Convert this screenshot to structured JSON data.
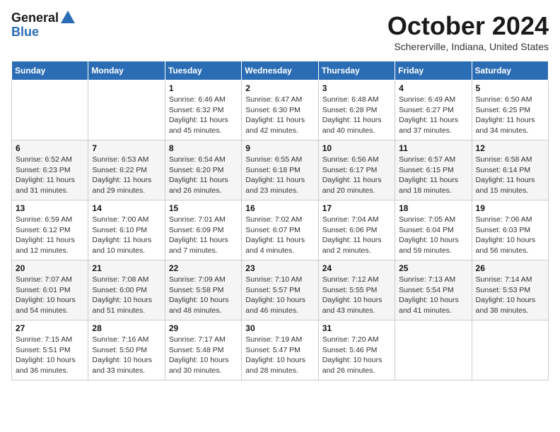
{
  "header": {
    "logo_general": "General",
    "logo_blue": "Blue",
    "month": "October 2024",
    "location": "Schererville, Indiana, United States"
  },
  "weekdays": [
    "Sunday",
    "Monday",
    "Tuesday",
    "Wednesday",
    "Thursday",
    "Friday",
    "Saturday"
  ],
  "weeks": [
    [
      {
        "day": "",
        "sunrise": "",
        "sunset": "",
        "daylight": ""
      },
      {
        "day": "",
        "sunrise": "",
        "sunset": "",
        "daylight": ""
      },
      {
        "day": "1",
        "sunrise": "Sunrise: 6:46 AM",
        "sunset": "Sunset: 6:32 PM",
        "daylight": "Daylight: 11 hours and 45 minutes."
      },
      {
        "day": "2",
        "sunrise": "Sunrise: 6:47 AM",
        "sunset": "Sunset: 6:30 PM",
        "daylight": "Daylight: 11 hours and 42 minutes."
      },
      {
        "day": "3",
        "sunrise": "Sunrise: 6:48 AM",
        "sunset": "Sunset: 6:28 PM",
        "daylight": "Daylight: 11 hours and 40 minutes."
      },
      {
        "day": "4",
        "sunrise": "Sunrise: 6:49 AM",
        "sunset": "Sunset: 6:27 PM",
        "daylight": "Daylight: 11 hours and 37 minutes."
      },
      {
        "day": "5",
        "sunrise": "Sunrise: 6:50 AM",
        "sunset": "Sunset: 6:25 PM",
        "daylight": "Daylight: 11 hours and 34 minutes."
      }
    ],
    [
      {
        "day": "6",
        "sunrise": "Sunrise: 6:52 AM",
        "sunset": "Sunset: 6:23 PM",
        "daylight": "Daylight: 11 hours and 31 minutes."
      },
      {
        "day": "7",
        "sunrise": "Sunrise: 6:53 AM",
        "sunset": "Sunset: 6:22 PM",
        "daylight": "Daylight: 11 hours and 29 minutes."
      },
      {
        "day": "8",
        "sunrise": "Sunrise: 6:54 AM",
        "sunset": "Sunset: 6:20 PM",
        "daylight": "Daylight: 11 hours and 26 minutes."
      },
      {
        "day": "9",
        "sunrise": "Sunrise: 6:55 AM",
        "sunset": "Sunset: 6:18 PM",
        "daylight": "Daylight: 11 hours and 23 minutes."
      },
      {
        "day": "10",
        "sunrise": "Sunrise: 6:56 AM",
        "sunset": "Sunset: 6:17 PM",
        "daylight": "Daylight: 11 hours and 20 minutes."
      },
      {
        "day": "11",
        "sunrise": "Sunrise: 6:57 AM",
        "sunset": "Sunset: 6:15 PM",
        "daylight": "Daylight: 11 hours and 18 minutes."
      },
      {
        "day": "12",
        "sunrise": "Sunrise: 6:58 AM",
        "sunset": "Sunset: 6:14 PM",
        "daylight": "Daylight: 11 hours and 15 minutes."
      }
    ],
    [
      {
        "day": "13",
        "sunrise": "Sunrise: 6:59 AM",
        "sunset": "Sunset: 6:12 PM",
        "daylight": "Daylight: 11 hours and 12 minutes."
      },
      {
        "day": "14",
        "sunrise": "Sunrise: 7:00 AM",
        "sunset": "Sunset: 6:10 PM",
        "daylight": "Daylight: 11 hours and 10 minutes."
      },
      {
        "day": "15",
        "sunrise": "Sunrise: 7:01 AM",
        "sunset": "Sunset: 6:09 PM",
        "daylight": "Daylight: 11 hours and 7 minutes."
      },
      {
        "day": "16",
        "sunrise": "Sunrise: 7:02 AM",
        "sunset": "Sunset: 6:07 PM",
        "daylight": "Daylight: 11 hours and 4 minutes."
      },
      {
        "day": "17",
        "sunrise": "Sunrise: 7:04 AM",
        "sunset": "Sunset: 6:06 PM",
        "daylight": "Daylight: 11 hours and 2 minutes."
      },
      {
        "day": "18",
        "sunrise": "Sunrise: 7:05 AM",
        "sunset": "Sunset: 6:04 PM",
        "daylight": "Daylight: 10 hours and 59 minutes."
      },
      {
        "day": "19",
        "sunrise": "Sunrise: 7:06 AM",
        "sunset": "Sunset: 6:03 PM",
        "daylight": "Daylight: 10 hours and 56 minutes."
      }
    ],
    [
      {
        "day": "20",
        "sunrise": "Sunrise: 7:07 AM",
        "sunset": "Sunset: 6:01 PM",
        "daylight": "Daylight: 10 hours and 54 minutes."
      },
      {
        "day": "21",
        "sunrise": "Sunrise: 7:08 AM",
        "sunset": "Sunset: 6:00 PM",
        "daylight": "Daylight: 10 hours and 51 minutes."
      },
      {
        "day": "22",
        "sunrise": "Sunrise: 7:09 AM",
        "sunset": "Sunset: 5:58 PM",
        "daylight": "Daylight: 10 hours and 48 minutes."
      },
      {
        "day": "23",
        "sunrise": "Sunrise: 7:10 AM",
        "sunset": "Sunset: 5:57 PM",
        "daylight": "Daylight: 10 hours and 46 minutes."
      },
      {
        "day": "24",
        "sunrise": "Sunrise: 7:12 AM",
        "sunset": "Sunset: 5:55 PM",
        "daylight": "Daylight: 10 hours and 43 minutes."
      },
      {
        "day": "25",
        "sunrise": "Sunrise: 7:13 AM",
        "sunset": "Sunset: 5:54 PM",
        "daylight": "Daylight: 10 hours and 41 minutes."
      },
      {
        "day": "26",
        "sunrise": "Sunrise: 7:14 AM",
        "sunset": "Sunset: 5:53 PM",
        "daylight": "Daylight: 10 hours and 38 minutes."
      }
    ],
    [
      {
        "day": "27",
        "sunrise": "Sunrise: 7:15 AM",
        "sunset": "Sunset: 5:51 PM",
        "daylight": "Daylight: 10 hours and 36 minutes."
      },
      {
        "day": "28",
        "sunrise": "Sunrise: 7:16 AM",
        "sunset": "Sunset: 5:50 PM",
        "daylight": "Daylight: 10 hours and 33 minutes."
      },
      {
        "day": "29",
        "sunrise": "Sunrise: 7:17 AM",
        "sunset": "Sunset: 5:48 PM",
        "daylight": "Daylight: 10 hours and 30 minutes."
      },
      {
        "day": "30",
        "sunrise": "Sunrise: 7:19 AM",
        "sunset": "Sunset: 5:47 PM",
        "daylight": "Daylight: 10 hours and 28 minutes."
      },
      {
        "day": "31",
        "sunrise": "Sunrise: 7:20 AM",
        "sunset": "Sunset: 5:46 PM",
        "daylight": "Daylight: 10 hours and 26 minutes."
      },
      {
        "day": "",
        "sunrise": "",
        "sunset": "",
        "daylight": ""
      },
      {
        "day": "",
        "sunrise": "",
        "sunset": "",
        "daylight": ""
      }
    ]
  ]
}
